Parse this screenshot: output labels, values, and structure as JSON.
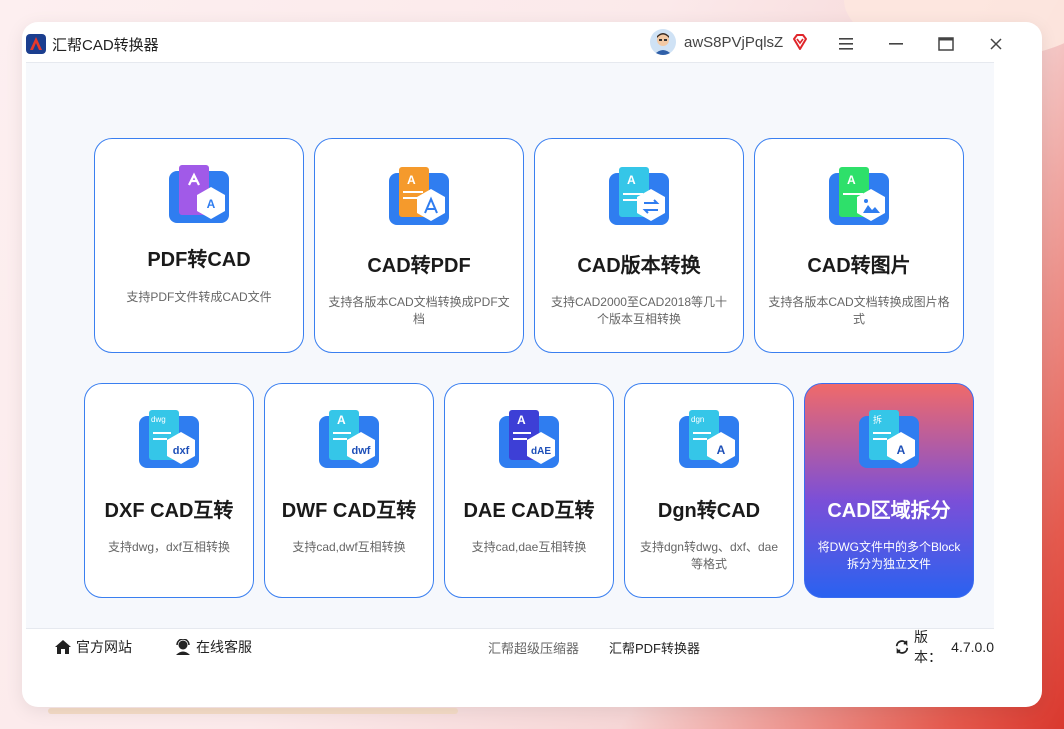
{
  "app": {
    "title": "汇帮CAD转换器"
  },
  "user": {
    "name": "awS8PVjPqlsZ"
  },
  "cards": [
    {
      "title": "PDF转CAD",
      "desc": "支持PDF文件转成CAD文件",
      "icon": "pdf-to-cad-icon",
      "badge": ""
    },
    {
      "title": "CAD转PDF",
      "desc": "支持各版本CAD文档转换成PDF文档",
      "icon": "cad-to-pdf-icon",
      "badge": ""
    },
    {
      "title": "CAD版本转换",
      "desc": "支持CAD2000至CAD2018等几十个版本互相转换",
      "icon": "cad-version-icon",
      "badge": ""
    },
    {
      "title": "CAD转图片",
      "desc": "支持各版本CAD文档转换成图片格式",
      "icon": "cad-to-image-icon",
      "badge": ""
    },
    {
      "title": "DXF CAD互转",
      "desc": "支持dwg，dxf互相转换",
      "icon": "dxf-icon",
      "badge": "dxf"
    },
    {
      "title": "DWF CAD互转",
      "desc": "支持cad,dwf互相转换",
      "icon": "dwf-icon",
      "badge": "dwf"
    },
    {
      "title": "DAE CAD互转",
      "desc": "支持cad,dae互相转换",
      "icon": "dae-icon",
      "badge": "dAE"
    },
    {
      "title": "Dgn转CAD",
      "desc": "支持dgn转dwg、dxf、dae等格式",
      "icon": "dgn-icon",
      "badge": "A"
    },
    {
      "title": "CAD区域拆分",
      "desc": "将DWG文件中的多个Block拆分为独立文件",
      "icon": "cad-split-icon",
      "badge": "A"
    }
  ],
  "footer": {
    "website": "官方网站",
    "support": "在线客服",
    "link1": "汇帮超级压缩器",
    "link2": "汇帮PDF转换器",
    "version_label": "版本：",
    "version": "4.7.0.0"
  },
  "colors": {
    "accent": "#3a7ff0",
    "active_top": "#f06a6a",
    "active_bottom": "#2a62f0"
  }
}
